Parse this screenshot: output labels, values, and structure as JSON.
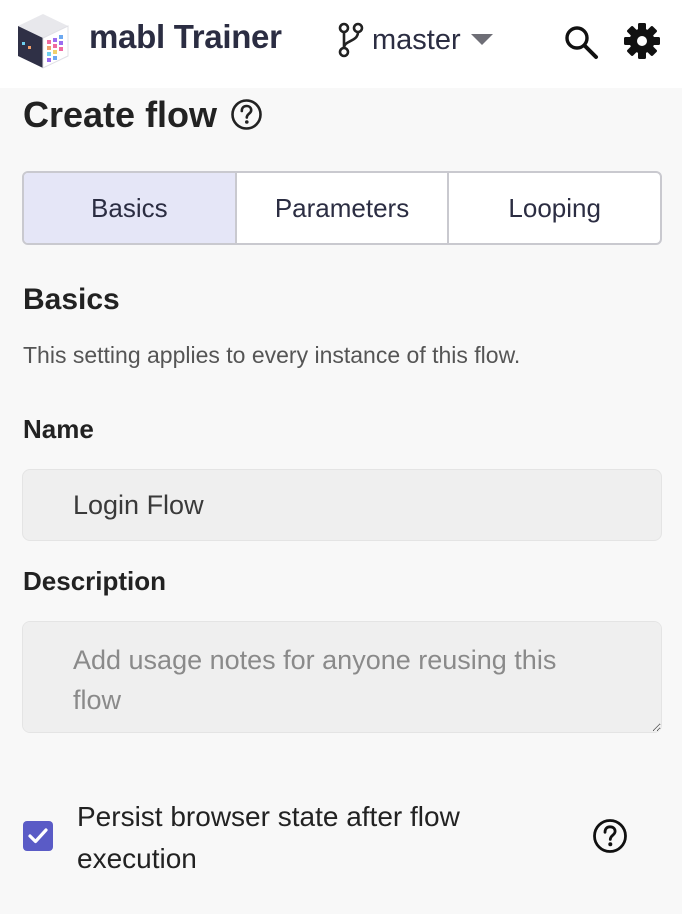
{
  "header": {
    "app_title": "mabl Trainer",
    "branch": "master"
  },
  "page": {
    "title": "Create flow"
  },
  "tabs": [
    {
      "label": "Basics",
      "active": true
    },
    {
      "label": "Parameters",
      "active": false
    },
    {
      "label": "Looping",
      "active": false
    }
  ],
  "basics": {
    "heading": "Basics",
    "description": "This setting applies to every instance of this flow.",
    "name_label": "Name",
    "name_value": "Login Flow",
    "description_label": "Description",
    "description_placeholder": "Add usage notes for anyone reusing this flow",
    "persist_label": "Persist browser state after flow execution",
    "persist_checked": true
  },
  "colors": {
    "accent": "#5a5bc6",
    "active_tab_bg": "#e5e6f7"
  },
  "icons": [
    "mabl-logo-icon",
    "git-branch-icon",
    "caret-down-icon",
    "search-icon",
    "gear-icon",
    "help-circle-icon",
    "checkmark-icon"
  ]
}
